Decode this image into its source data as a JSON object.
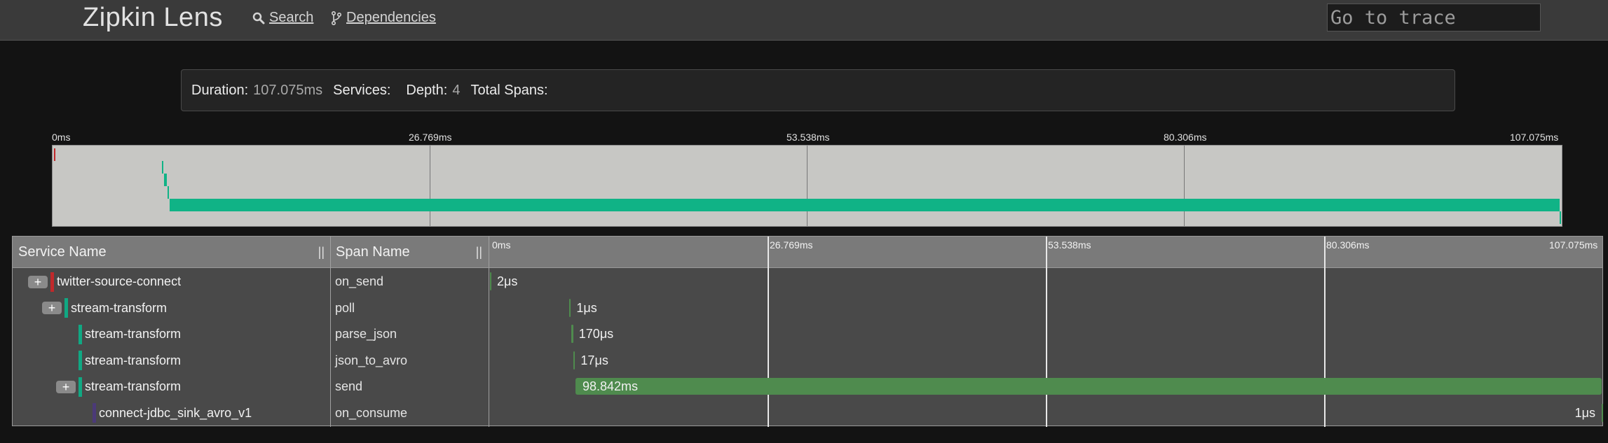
{
  "app": {
    "brand": "Zipkin Lens",
    "nav": {
      "search": "Search",
      "dependencies": "Dependencies"
    },
    "goto_placeholder": "Go to trace"
  },
  "summary": {
    "duration_label": "Duration:",
    "duration_value": "107.075ms",
    "services_label": "Services:",
    "services_value": "",
    "depth_label": "Depth:",
    "depth_value": "4",
    "total_spans_label": "Total Spans:",
    "total_spans_value": ""
  },
  "timeline": {
    "ticks": [
      "0ms",
      "26.769ms",
      "53.538ms",
      "80.306ms",
      "107.075ms"
    ]
  },
  "table": {
    "service_header": "Service Name",
    "span_header": "Span Name",
    "resize_grip": "||"
  },
  "colors": {
    "root_service": "#c0292b",
    "stream_service": "#10a883",
    "sink_service": "#4b3a78",
    "span_bar": "#4f8b4e",
    "minimap_bar": "#10b386"
  },
  "spans": [
    {
      "service": "twitter-source-connect",
      "span": "on_send",
      "duration": "2μs",
      "depth": 0,
      "expandable": true,
      "color": "#c0292b",
      "start_fraction": 0.0,
      "duration_fraction": 0.0001
    },
    {
      "service": "stream-transform",
      "span": "poll",
      "duration": "1μs",
      "depth": 1,
      "expandable": true,
      "color": "#10a883",
      "start_fraction": 0.0715,
      "duration_fraction": 0.0001
    },
    {
      "service": "stream-transform",
      "span": "parse_json",
      "duration": "170μs",
      "depth": 2,
      "expandable": false,
      "color": "#10a883",
      "start_fraction": 0.0733,
      "duration_fraction": 0.0016
    },
    {
      "service": "stream-transform",
      "span": "json_to_avro",
      "duration": "17μs",
      "depth": 2,
      "expandable": false,
      "color": "#10a883",
      "start_fraction": 0.0753,
      "duration_fraction": 0.0002
    },
    {
      "service": "stream-transform",
      "span": "send",
      "duration": "98.842ms",
      "depth": 2,
      "expandable": true,
      "color": "#10a883",
      "start_fraction": 0.0769,
      "duration_fraction": 0.9231
    },
    {
      "service": "connect-jdbc_sink_avro_v1",
      "span": "on_consume",
      "duration": "1μs",
      "depth": 3,
      "expandable": false,
      "color": "#4b3a78",
      "start_fraction": 0.9999,
      "duration_fraction": 0.0001
    }
  ]
}
